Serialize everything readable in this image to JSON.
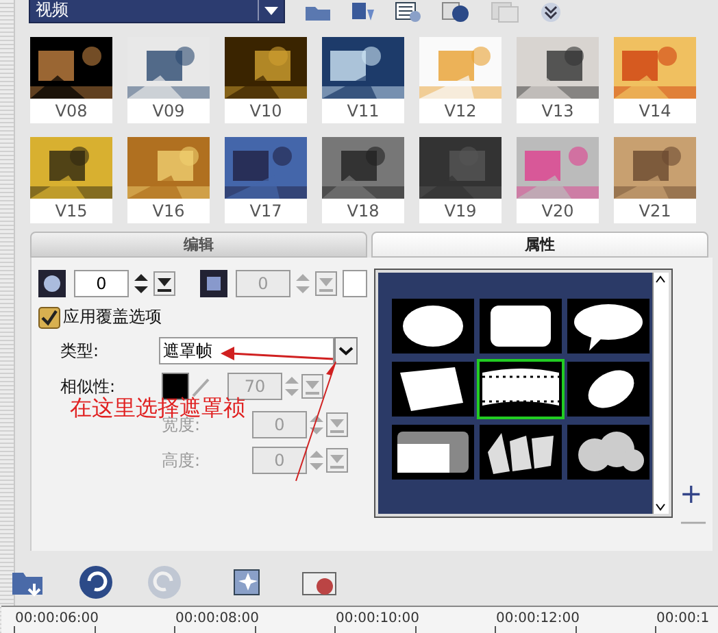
{
  "media_type": {
    "value": "视频"
  },
  "clips": [
    {
      "label": "V08"
    },
    {
      "label": "V09"
    },
    {
      "label": "V10"
    },
    {
      "label": "V11"
    },
    {
      "label": "V12"
    },
    {
      "label": "V13"
    },
    {
      "label": "V14"
    },
    {
      "label": "V15"
    },
    {
      "label": "V16"
    },
    {
      "label": "V17"
    },
    {
      "label": "V18"
    },
    {
      "label": "V19"
    },
    {
      "label": "V20"
    },
    {
      "label": "V21"
    }
  ],
  "tabs": [
    {
      "label": "编辑",
      "selected": false
    },
    {
      "label": "属性",
      "selected": true
    }
  ],
  "border_row": {
    "value": "0",
    "disabled": false
  },
  "shadow_row": {
    "value": "0",
    "disabled": true
  },
  "overlay_option": {
    "label": "应用覆盖选项",
    "checked": true
  },
  "type_field": {
    "label": "类型:",
    "value": "遮罩帧"
  },
  "similarity": {
    "label": "相似性:",
    "value": "70",
    "disabled": true
  },
  "width_field": {
    "label": "宽度:",
    "value": "0",
    "disabled": true
  },
  "height_field": {
    "label": "高度:",
    "value": "0",
    "disabled": true
  },
  "annotation": {
    "text": "在这里选择遮罩祯"
  },
  "masks": [
    {
      "kind": "oval",
      "selected": false
    },
    {
      "kind": "rounded",
      "selected": false
    },
    {
      "kind": "bubble",
      "selected": false
    },
    {
      "kind": "paper",
      "selected": false
    },
    {
      "kind": "film",
      "selected": true
    },
    {
      "kind": "tilted",
      "selected": false
    },
    {
      "kind": "frames",
      "selected": false
    },
    {
      "kind": "strips",
      "selected": false
    },
    {
      "kind": "blobs",
      "selected": false
    }
  ],
  "zoom_controls": [
    "+",
    "—"
  ],
  "timeline": [
    "00:00:06:00",
    "00:00:08:00",
    "00:00:10:00",
    "00:00:12:00",
    "00:00:1"
  ]
}
